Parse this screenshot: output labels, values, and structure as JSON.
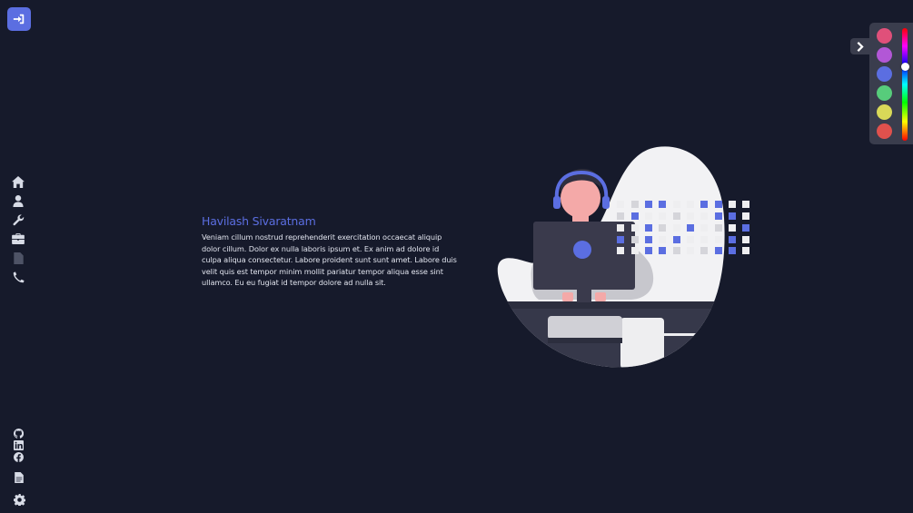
{
  "hero": {
    "name": "Havilash Sivaratnam",
    "bio": "Veniam cillum nostrud reprehenderit exercitation occaecat aliquip dolor cillum. Dolor ex nulla laboris ipsum et. Ex anim ad dolore id culpa aliqua consectetur. Labore proident sunt sunt amet. Labore duis velit quis est tempor minim mollit pariatur tempor aliqua esse sint ullamco. Eu eu fugiat id tempor dolore ad nulla sit."
  },
  "nav": {
    "items": [
      {
        "icon": "home-icon"
      },
      {
        "icon": "user-icon"
      },
      {
        "icon": "wrench-icon"
      },
      {
        "icon": "briefcase-icon"
      },
      {
        "icon": "document-icon"
      },
      {
        "icon": "phone-icon"
      }
    ],
    "social": [
      "github-icon",
      "linkedin-icon",
      "facebook-icon"
    ],
    "footer": [
      "resume-icon",
      "settings-icon"
    ]
  },
  "theme": {
    "accent": "#5b6ee1",
    "background": "#161a2b",
    "swatches": [
      "#e0507a",
      "#b257d6",
      "#5b6ee1",
      "#57cc7b",
      "#d9d958",
      "#e0514d"
    ],
    "selected_swatch": "#5b6ee1"
  }
}
